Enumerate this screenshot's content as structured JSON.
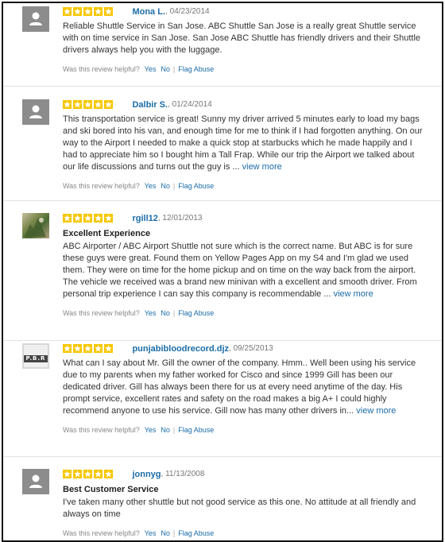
{
  "helpful": {
    "question": "Was this review helpful?",
    "yes": "Yes",
    "no": "No",
    "flag": "Flag Abuse"
  },
  "view_more": "view more",
  "colors": {
    "link": "#1b6ca8",
    "star": "#f6c700",
    "avatar": "#8c8c8c"
  },
  "reviews": [
    {
      "avatar_icon": "user-silhouette-icon",
      "rating": 5,
      "reviewer": "Mona L.",
      "date": ", 04/23/2014",
      "headline": "",
      "body": "Reliable Shuttle Service in San Jose. ABC Shuttle San Jose is a really great Shuttle service with on time service in San Jose. San Jose ABC Shuttle has friendly drivers and their Shuttle drivers always help you with the luggage."
    },
    {
      "avatar_icon": "user-silhouette-icon",
      "rating": 5,
      "reviewer": "Dalbir S.",
      "date": ", 01/24/2014",
      "headline": "",
      "body": "This transportation service is great! Sunny my driver arrived 5 minutes early to load my bags and ski bored into his van, and enough time for me to think if I had forgotten anything. On our way to the Airport I needed to make a quick stop at starbucks which he made happily and I had to appreciate him so I bought him a Tall Frap. While our trip the Airport we talked about our life discussions and turns out the guy is ..."
    },
    {
      "avatar_icon": "profile-photo",
      "rating": 5,
      "reviewer": "rgill12",
      "date": ", 12/01/2013",
      "headline": "Excellent Experience",
      "body": "ABC Airporter / ABC Airport Shuttle not sure which is the correct name. But ABC is for sure these guys were great. Found them on Yellow Pages App on my S4 and I'm glad we used them. They were on time for the home pickup and on time on the way back from the airport. The vehicle we received was a brand new minivan with a excellent and smooth driver. From personal trip experience I can say this company is recommendable ..."
    },
    {
      "avatar_icon": "profile-logo",
      "avatar_text": "P.B.R",
      "rating": 5,
      "reviewer": "punjabibloodrecord.djz",
      "date": ", 09/25/2013",
      "headline": "",
      "body": "What can I say about Mr. Gill the owner of the company. Hmm.. Well been using his service due to my parents when my father worked for Cisco and since 1999 Gill has been our dedicated driver. Gill has always been there for us at every need anytime of the day. His prompt service, excellent rates and safety on the road makes a big A+ I could highly recommend anyone to use his service. Gill now has many other drivers in..."
    },
    {
      "avatar_icon": "user-silhouette-icon",
      "rating": 5,
      "reviewer": "jonnyg",
      "date": ", 11/13/2008",
      "headline": "Best Customer Service",
      "body": "I've taken many other shuttle but not good service as this one. No attitude at all friendly and always on time"
    }
  ]
}
